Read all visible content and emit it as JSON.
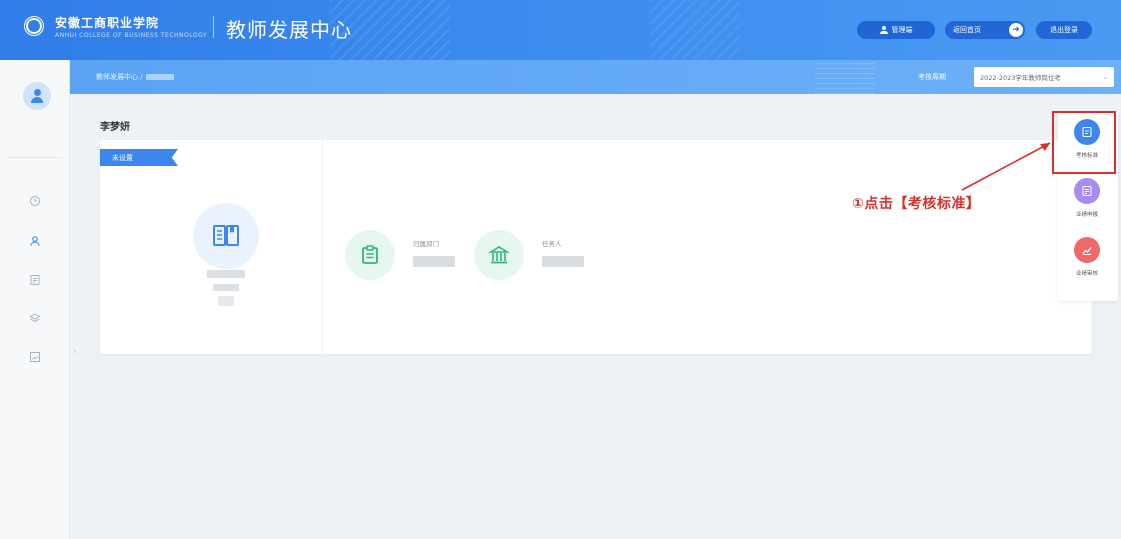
{
  "header": {
    "school_name": "安徽工商职业学院",
    "school_sub": "ANHUI COLLEGE OF BUSINESS TECHNOLOGY",
    "app_title": "教师发展中心",
    "user_label": "管理端",
    "back_label": "返回首页",
    "logout_label": "退出登录",
    "accent": "#2f7de8"
  },
  "subbar": {
    "breadcrumb": "教师发展中心 /",
    "period_label": "考核周期",
    "period_value": "2022-2023学年教师岗位考",
    "period_chevron": "⌄"
  },
  "sidebar": {
    "avatar_icon": "user-avatar-icon",
    "items": [
      {
        "icon": "clock-icon"
      },
      {
        "icon": "person-icon"
      },
      {
        "icon": "document-icon"
      },
      {
        "icon": "layers-icon"
      },
      {
        "icon": "report-icon"
      }
    ],
    "expand": "›"
  },
  "main": {
    "teacher_name": "李梦妍",
    "status": "未设置",
    "field1_label": "归属部门",
    "field2_label": "任务人"
  },
  "float_panel": {
    "items": [
      {
        "label": "考核标准",
        "color": "#3d86ec",
        "icon": "standard-icon"
      },
      {
        "label": "业绩申报",
        "color": "#a78bf0",
        "icon": "declare-icon"
      },
      {
        "label": "业绩审核",
        "color": "#ee6a6a",
        "icon": "audit-icon"
      }
    ]
  },
  "annotation": {
    "text": "①点击【考核标准】",
    "color": "#d9302b"
  }
}
